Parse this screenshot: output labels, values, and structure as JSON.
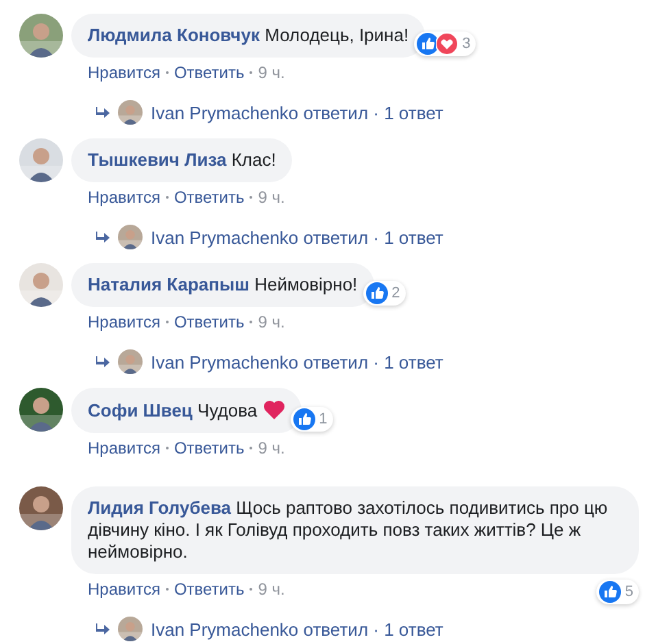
{
  "comments": [
    {
      "author": "Людмила Коновчук",
      "text": "Молодець, Ірина!",
      "reactions": {
        "icons": [
          {
            "kind": "like"
          },
          {
            "kind": "love"
          }
        ],
        "count": "3"
      },
      "actions": [
        "Нравится",
        "Ответить"
      ],
      "time": "9 ч.",
      "reply": "Ivan Prymachenko ответил · 1 ответ"
    },
    {
      "author": "Тышкевич Лиза",
      "text": "Клас!",
      "actions": [
        "Нравится",
        "Ответить"
      ],
      "time": "9 ч.",
      "reply": "Ivan Prymachenko ответил · 1 ответ"
    },
    {
      "author": "Наталия Карапыш",
      "text": "Неймовірно!",
      "reactions": {
        "icons": [
          {
            "kind": "like"
          }
        ],
        "count": "2"
      },
      "actions": [
        "Нравится",
        "Ответить"
      ],
      "time": "9 ч.",
      "reply": "Ivan Prymachenko ответил · 1 ответ"
    },
    {
      "author": "Софи Швец",
      "text": "Чудова",
      "emoji": {
        "kind": "heart"
      },
      "reactions": {
        "icons": [
          {
            "kind": "like"
          }
        ],
        "count": "1"
      },
      "actions": [
        "Нравится",
        "Ответить"
      ],
      "time": "9 ч."
    },
    {
      "author": "Лидия Голубева",
      "text": "Щось раптово захотілось подивитись про цю дівчину кіно. І як Голівуд проходить повз таких життів? Це ж неймовірно.",
      "reactions": {
        "icons": [
          {
            "kind": "like"
          }
        ],
        "count": "5"
      },
      "actions": [
        "Нравится",
        "Ответить"
      ],
      "time": "9 ч.",
      "reply": "Ivan Prymachenko ответил · 1 ответ"
    }
  ]
}
